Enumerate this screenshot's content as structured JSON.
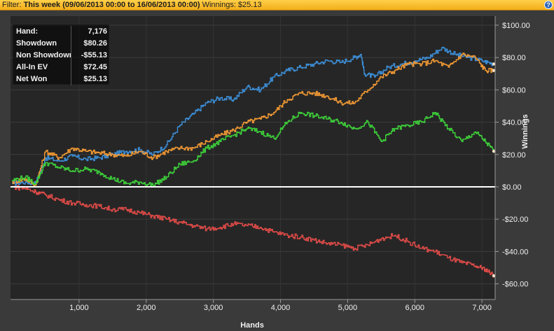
{
  "filter": {
    "label": "Filter:",
    "value": "This week (09/06/2013 00:00 to 16/06/2013 00:00)",
    "winnings_text": "Winnings: $25.13"
  },
  "help_icon": "?",
  "colors": {
    "net_won": "#3d8fd8",
    "all_in_ev": "#f39a34",
    "showdown": "#3ed23a",
    "non_showdown": "#e04b48",
    "zero_line": "#ffffff"
  },
  "stats": [
    {
      "label": "Hand:",
      "value": "7,176"
    },
    {
      "label": "Showdown",
      "value": "$80.26"
    },
    {
      "label": "Non Showdown",
      "value": "-$55.13"
    },
    {
      "label": "All-In EV",
      "value": "$72.45"
    },
    {
      "label": "Net Won",
      "value": "$25.13"
    }
  ],
  "chart_data": {
    "type": "line",
    "xlabel": "Hands",
    "ylabel": "Winnings",
    "xlim": [
      0,
      7176
    ],
    "ylim": [
      -70,
      100
    ],
    "x_ticks": [
      1000,
      2000,
      3000,
      4000,
      5000,
      6000,
      7000
    ],
    "x_tick_labels": [
      "1,000",
      "2,000",
      "3,000",
      "4,000",
      "5,000",
      "6,000",
      "7,000"
    ],
    "y_ticks": [
      100,
      80,
      60,
      40,
      20,
      0,
      -20,
      -40,
      -60
    ],
    "y_tick_labels": [
      "$100.00",
      "$80.00",
      "$60.00",
      "$40.00",
      "$20.00",
      "$0.00",
      "-$20.00",
      "-$40.00",
      "-$60.00"
    ],
    "grid": true,
    "series": [
      {
        "name": "Net Won",
        "color": "#3d8fd8",
        "x": [
          0,
          200,
          350,
          500,
          700,
          900,
          1100,
          1300,
          1500,
          1700,
          1900,
          2100,
          2300,
          2500,
          2700,
          2900,
          3100,
          3300,
          3500,
          3700,
          3900,
          4100,
          4300,
          4500,
          4700,
          4900,
          5100,
          5200,
          5250,
          5400,
          5600,
          5800,
          6000,
          6200,
          6400,
          6600,
          6800,
          7000,
          7176
        ],
        "values": [
          2,
          3,
          2,
          18,
          16,
          19,
          17,
          18,
          20,
          22,
          23,
          20,
          26,
          38,
          45,
          52,
          55,
          54,
          62,
          60,
          68,
          72,
          74,
          76,
          78,
          77,
          80,
          82,
          70,
          68,
          74,
          76,
          78,
          80,
          86,
          82,
          80,
          78,
          76
        ]
      },
      {
        "name": "All-In EV",
        "color": "#f39a34",
        "x": [
          0,
          200,
          350,
          500,
          700,
          900,
          1100,
          1300,
          1500,
          1700,
          1900,
          2100,
          2300,
          2500,
          2700,
          2900,
          3100,
          3300,
          3500,
          3700,
          3900,
          4100,
          4300,
          4500,
          4700,
          4900,
          5100,
          5300,
          5500,
          5700,
          5900,
          6100,
          6300,
          6500,
          6700,
          6900,
          7050,
          7176
        ],
        "values": [
          3,
          5,
          1,
          22,
          18,
          24,
          22,
          21,
          20,
          19,
          22,
          18,
          22,
          24,
          24,
          28,
          32,
          35,
          40,
          42,
          46,
          54,
          58,
          58,
          56,
          52,
          52,
          60,
          68,
          72,
          76,
          76,
          78,
          74,
          82,
          80,
          72,
          72
        ]
      },
      {
        "name": "Showdown",
        "color": "#3ed23a",
        "x": [
          0,
          200,
          350,
          500,
          700,
          900,
          1100,
          1300,
          1500,
          1700,
          1900,
          2100,
          2300,
          2500,
          2700,
          2900,
          3100,
          3300,
          3500,
          3700,
          3900,
          4100,
          4300,
          4500,
          4700,
          4900,
          5100,
          5300,
          5500,
          5700,
          5900,
          6100,
          6300,
          6500,
          6700,
          6900,
          7050,
          7176
        ],
        "values": [
          4,
          6,
          2,
          15,
          12,
          10,
          11,
          9,
          5,
          2,
          3,
          1,
          6,
          14,
          16,
          24,
          28,
          32,
          36,
          34,
          30,
          40,
          46,
          44,
          42,
          40,
          36,
          40,
          28,
          36,
          38,
          40,
          46,
          36,
          28,
          34,
          28,
          22
        ]
      },
      {
        "name": "Non Showdown",
        "color": "#e04b48",
        "x": [
          0,
          200,
          350,
          500,
          700,
          900,
          1100,
          1300,
          1500,
          1700,
          1900,
          2100,
          2300,
          2500,
          2700,
          2900,
          3100,
          3300,
          3500,
          3700,
          3900,
          4100,
          4300,
          4500,
          4700,
          4900,
          5100,
          5300,
          5500,
          5700,
          5900,
          6100,
          6300,
          6500,
          6700,
          6900,
          7050,
          7176
        ],
        "values": [
          0,
          -1,
          -3,
          -5,
          -8,
          -10,
          -11,
          -12,
          -14,
          -14,
          -16,
          -18,
          -20,
          -22,
          -24,
          -26,
          -25,
          -23,
          -24,
          -25,
          -28,
          -30,
          -31,
          -33,
          -35,
          -36,
          -38,
          -36,
          -32,
          -30,
          -34,
          -38,
          -40,
          -44,
          -47,
          -49,
          -51,
          -55
        ]
      }
    ]
  }
}
